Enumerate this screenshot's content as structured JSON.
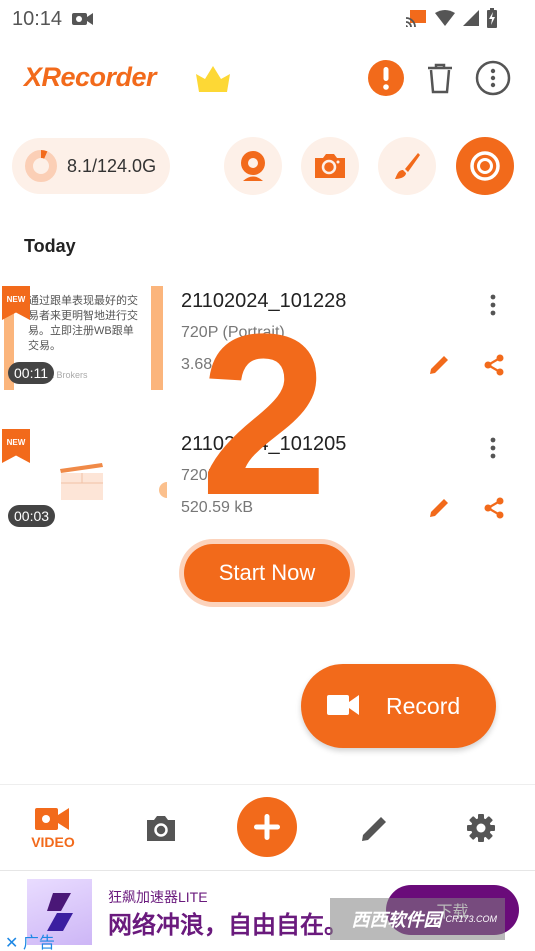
{
  "status_bar": {
    "time": "10:14",
    "icons": [
      "video-record-icon",
      "cast-icon",
      "wifi-icon",
      "signal-icon",
      "battery-charging-icon"
    ]
  },
  "app_bar": {
    "title": "XRecorder",
    "premium_icon": "crown-icon",
    "actions": [
      "alert-icon",
      "trash-icon",
      "more-vert-icon"
    ]
  },
  "storage": {
    "label": "8.1/124.0G",
    "used_fraction": 0.065
  },
  "quick_actions": [
    {
      "name": "facecam",
      "icon": "webcam-icon"
    },
    {
      "name": "screenshot",
      "icon": "camera-icon"
    },
    {
      "name": "brush",
      "icon": "brush-icon"
    },
    {
      "name": "record",
      "icon": "record-icon"
    }
  ],
  "section_title": "Today",
  "recordings": [
    {
      "badge": "NEW",
      "duration": "00:11",
      "title": "21102024_101228",
      "resolution": "720P (Portrait)",
      "size": "3.68",
      "thumbnail_text": "通过跟单表现最好的交易者来更明智地进行交易。立即注册WB跟单交易。",
      "thumbnail_brand": "Wikifx Brokers"
    },
    {
      "badge": "NEW",
      "duration": "00:03",
      "title": "21102024_101205",
      "resolution": "720P (Portrait)",
      "size": "520.59 kB"
    }
  ],
  "start_now_label": "Start Now",
  "countdown": "2",
  "record_button": {
    "label": "Record",
    "icon": "videocam-icon"
  },
  "bottom_nav": {
    "items": [
      {
        "label": "VIDEO",
        "icon": "videocam-icon",
        "active": true
      },
      {
        "label": "",
        "icon": "camera-icon",
        "active": false
      },
      {
        "label": "",
        "icon": "plus-icon",
        "active": false
      },
      {
        "label": "",
        "icon": "edit-icon",
        "active": false
      },
      {
        "label": "",
        "icon": "settings-icon",
        "active": false
      }
    ]
  },
  "ad": {
    "app_name": "狂飙加速器LITE",
    "slogan": "网络冲浪，自由自在。",
    "cta": "下载",
    "close_label": "✕ 广告",
    "watermark": "西西软件园",
    "watermark_sub": "CR173.COM"
  },
  "colors": {
    "accent": "#f26a1b",
    "accent_light": "#fdf0e8",
    "ad_purple": "#6a0b7a"
  }
}
